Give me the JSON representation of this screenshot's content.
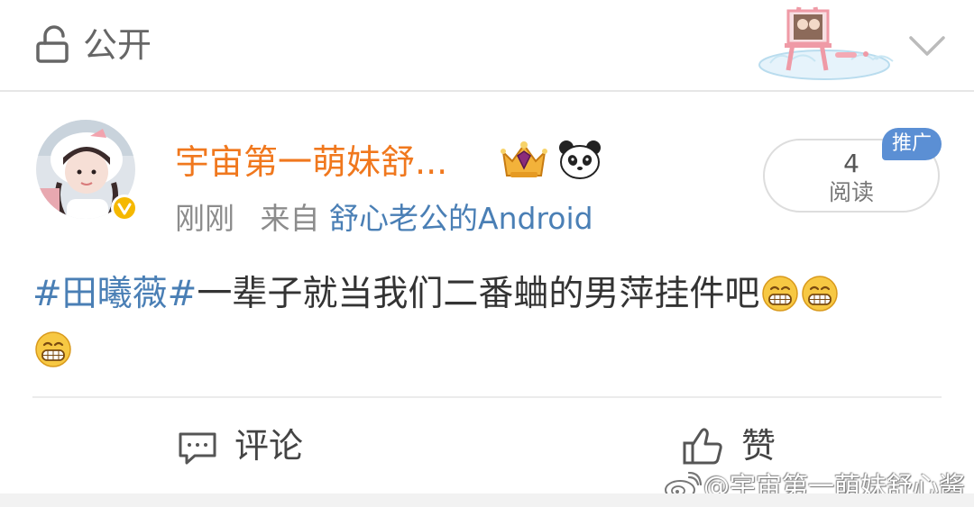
{
  "header": {
    "visibility_label": "公开",
    "lock_icon": "unlock-icon",
    "expand_icon": "chevron-down-icon"
  },
  "post": {
    "author_name": "宇宙第一萌妹舒...",
    "time": "刚刚",
    "from_label": "来自",
    "source": "舒心老公的Android",
    "hashtag": "#田曦薇#",
    "text": "一辈子就当我们二番蛐的男萍挂件吧",
    "emoji": "grin-emoji",
    "read_count": "4",
    "read_label": "阅读",
    "promo_badge": "推广"
  },
  "actions": {
    "comment_label": "评论",
    "like_label": "赞"
  },
  "watermark": {
    "text": "@宇宙第一萌妹舒心酱"
  },
  "colors": {
    "author_orange": "#f0781e",
    "link_blue": "#4a7fb5",
    "badge_blue": "#5b8fd4",
    "verified_gold": "#f5b800"
  }
}
